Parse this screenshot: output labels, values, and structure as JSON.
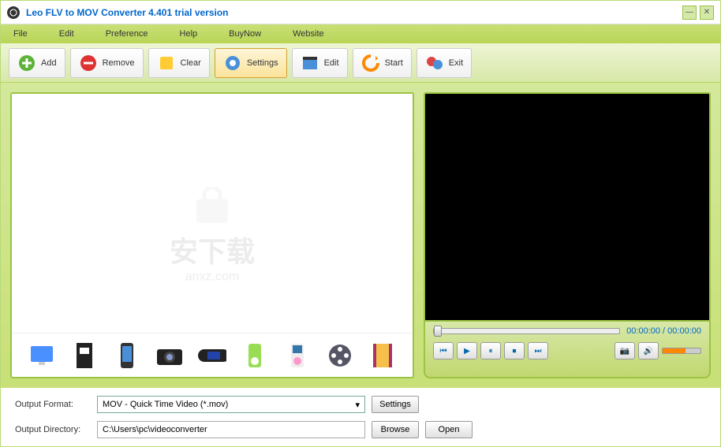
{
  "title": "Leo FLV to MOV Converter 4.401  trial version",
  "menu": {
    "file": "File",
    "edit": "Edit",
    "preference": "Preference",
    "help": "Help",
    "buynow": "BuyNow",
    "website": "Website"
  },
  "toolbar": {
    "add": "Add",
    "remove": "Remove",
    "clear": "Clear",
    "settings": "Settings",
    "edit": "Edit",
    "start": "Start",
    "exit": "Exit"
  },
  "preview": {
    "time_current": "00:00:00",
    "time_separator": " / ",
    "time_total": "00:00:00"
  },
  "form": {
    "output_format_label": "Output Format:",
    "output_format_value": "MOV - Quick Time Video (*.mov)",
    "settings_btn": "Settings",
    "output_directory_label": "Output Directory:",
    "output_directory_value": "C:\\Users\\pc\\videoconverter",
    "browse_btn": "Browse",
    "open_btn": "Open"
  },
  "watermark": {
    "main": "安下载",
    "sub": "anxz.com"
  }
}
